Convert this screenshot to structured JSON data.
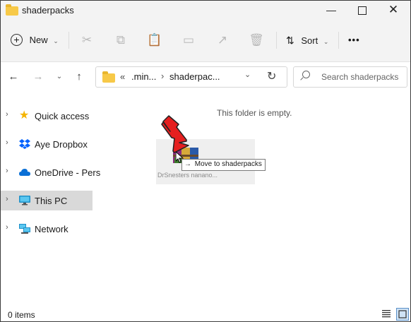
{
  "window": {
    "title": "shaderpacks"
  },
  "toolbar": {
    "new_label": "New",
    "sort_label": "Sort",
    "more_label": "•••"
  },
  "address": {
    "prefix": "«",
    "crumb1": ".min...",
    "crumb2": "shaderpac..."
  },
  "search": {
    "placeholder": "Search shaderpacks"
  },
  "sidebar": {
    "items": [
      {
        "label": "Quick access"
      },
      {
        "label": "Aye Dropbox"
      },
      {
        "label": "OneDrive - Pers"
      },
      {
        "label": "This PC"
      },
      {
        "label": "Network"
      }
    ]
  },
  "content": {
    "empty_text": "This folder is empty.",
    "drag_tooltip": "Move to shaderpacks",
    "drag_file_name": "DrSnesters nanano..."
  },
  "status": {
    "item_count": "0 items"
  },
  "colors": {
    "selected_bg": "#d9d9d9",
    "arrow_red": "#e51f1f",
    "folder_yellow": "#f7c948"
  }
}
